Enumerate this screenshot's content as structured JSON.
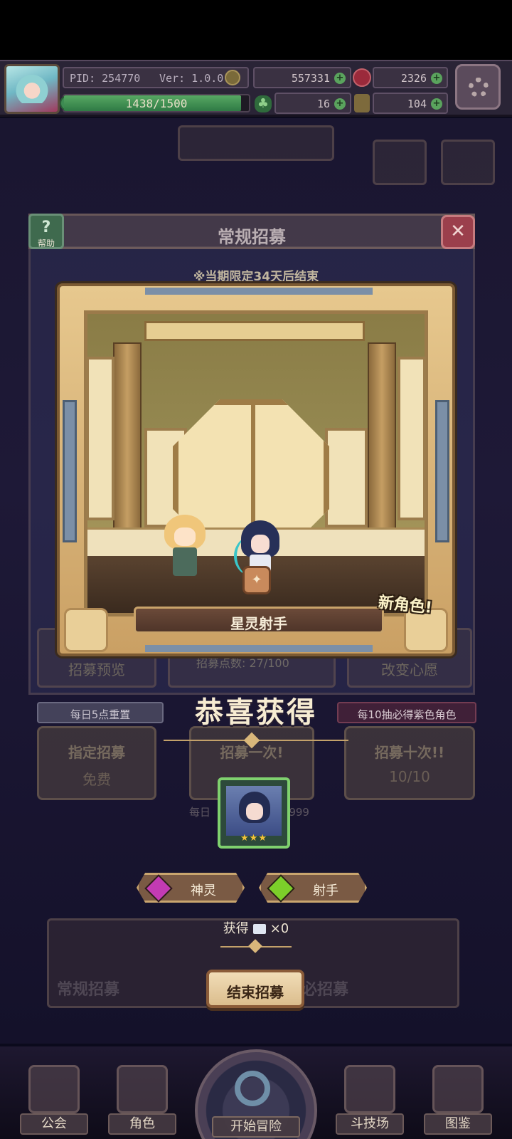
{
  "hud": {
    "pid": "PID: 254770",
    "version": "Ver: 1.0.0.1",
    "gold": "557331",
    "gems": "2326",
    "xp_text": "1438/1500",
    "xp_progress": 0.959,
    "clover": "16",
    "item": "104"
  },
  "dialog": {
    "title": "常规招募",
    "help_label": "帮助",
    "limited_note": "※当期限定34天后结束"
  },
  "reveal": {
    "character_name": "星灵射手",
    "new_badge": "新角色!"
  },
  "under": {
    "preview": "招募预览",
    "points": "招募点数: 27/100",
    "change_wish": "改变心愿",
    "reset_tag": "每日5点重置",
    "guarantee_tag": "每10抽必得紫色角色",
    "designate": "指定招募",
    "designate_cost": "免费",
    "recruit_one": "招募一次!",
    "recruit_ten": "招募十次!!",
    "recruit_ten_cost": "10/10",
    "daily": "每日",
    "daily_count": "9999"
  },
  "result": {
    "congrats": "恭喜获得",
    "stars": "★★★",
    "tag_race": "神灵",
    "tag_class": "射手",
    "race_color": "#c33bb3",
    "class_color": "#7ccf2a",
    "obtain_label": "获得",
    "obtain_count": "×0",
    "end_button": "结束招募"
  },
  "bottom_banners": {
    "regular": "常规招募",
    "must": "必招募"
  },
  "nav": {
    "guild": "公会",
    "character": "角色",
    "adventure": "开始冒险",
    "arena": "斗技场",
    "codex": "图鉴"
  },
  "icons": [
    "settings-gear-icon",
    "help-icon",
    "close-icon",
    "coin-icon",
    "gem-icon",
    "clover-icon",
    "item-icon",
    "ticket-icon",
    "magnifier-icon"
  ]
}
